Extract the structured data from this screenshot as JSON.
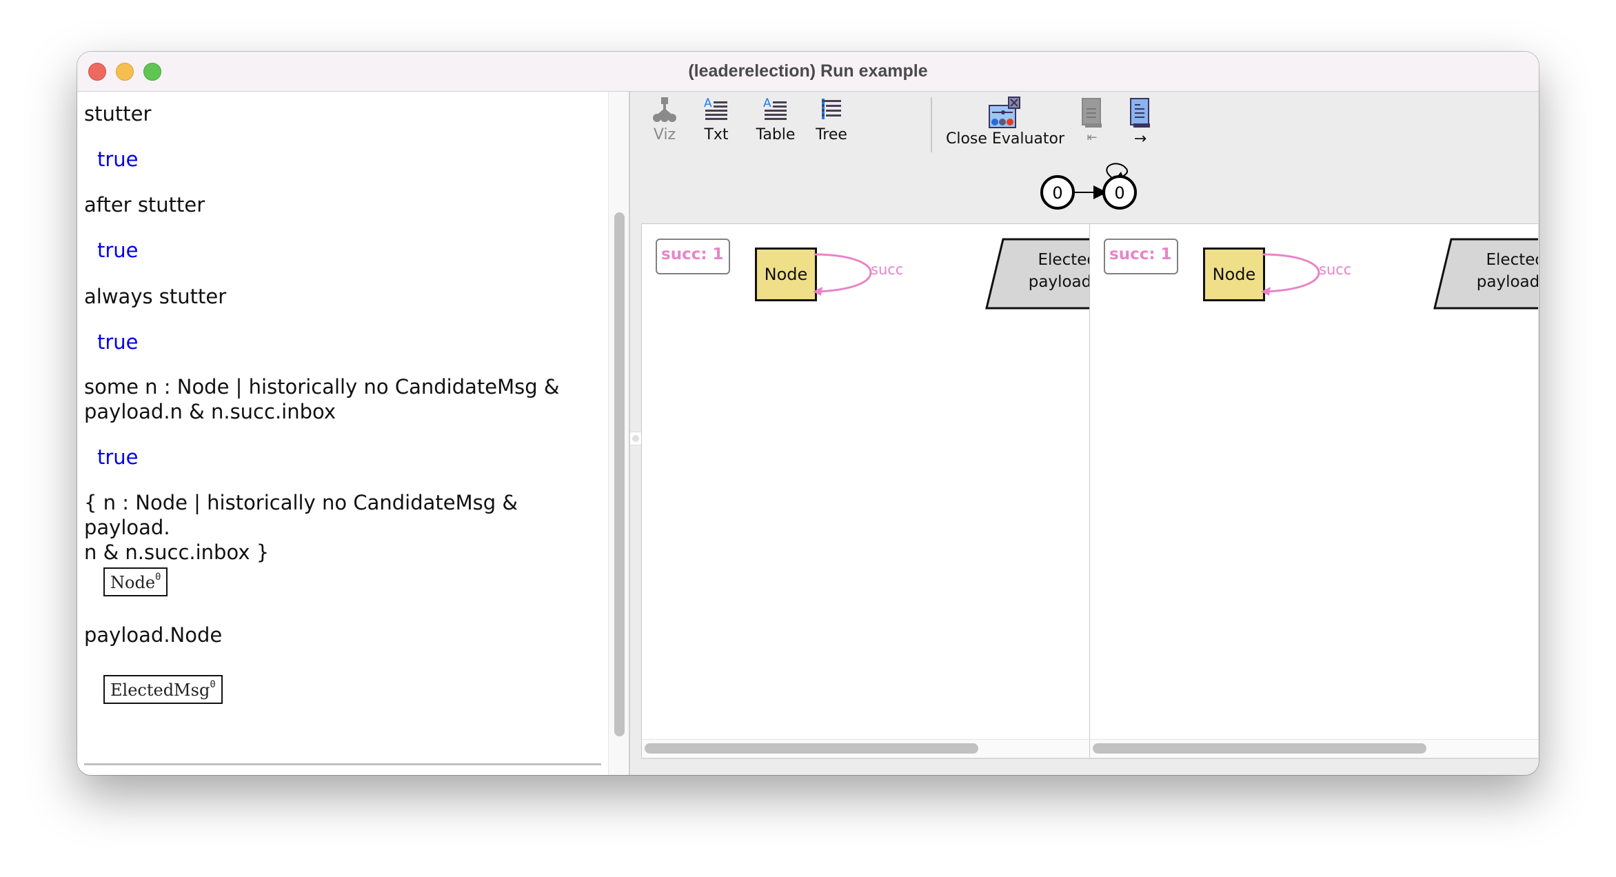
{
  "window": {
    "title": "(leaderelection) Run example"
  },
  "evaluator_log": [
    {
      "expr": "stutter",
      "result": "true"
    },
    {
      "expr": "after stutter",
      "result": "true"
    },
    {
      "expr": "always stutter",
      "result": "true"
    },
    {
      "expr": "some n : Node | historically no CandidateMsg &\npayload.n & n.succ.inbox",
      "result": "true"
    },
    {
      "expr": "{ n : Node | historically no CandidateMsg & payload.\nn & n.succ.inbox }",
      "atom": {
        "name": "Node",
        "sup": "0"
      }
    },
    {
      "expr": "payload.Node",
      "atom": {
        "name": "ElectedMsg",
        "sup": "0"
      }
    }
  ],
  "input": {
    "value": ""
  },
  "toolbar": {
    "buttons": [
      {
        "label": "Viz",
        "icon": "viz-graph-icon",
        "enabled": false
      },
      {
        "label": "Txt",
        "icon": "text-icon",
        "enabled": true
      },
      {
        "label": "Table",
        "icon": "table-icon",
        "enabled": true
      },
      {
        "label": "Tree",
        "icon": "tree-icon",
        "enabled": true
      },
      {
        "label": "Close Evaluator",
        "icon": "evaluator-close-icon",
        "enabled": true
      },
      {
        "label": "⇤",
        "icon": "scroll-first-icon",
        "enabled": false
      },
      {
        "label": "→",
        "icon": "scroll-next-icon",
        "enabled": true
      }
    ]
  },
  "state_graph": {
    "states": [
      "0",
      "0"
    ],
    "self_loop_on": 1
  },
  "viz_panels": [
    {
      "counter_label": "succ: 1",
      "node_label": "Node",
      "edge_label": "succ",
      "elected_lines": [
        "Elected",
        "payload:"
      ]
    },
    {
      "counter_label": "succ: 1",
      "node_label": "Node",
      "edge_label": "succ",
      "elected_lines": [
        "Elected",
        "payload:"
      ]
    }
  ],
  "colors": {
    "result_true": "#0000ee",
    "node_fill": "#efdf88",
    "edge_pink": "#e884c8",
    "elected_fill": "#d6d6d6"
  }
}
